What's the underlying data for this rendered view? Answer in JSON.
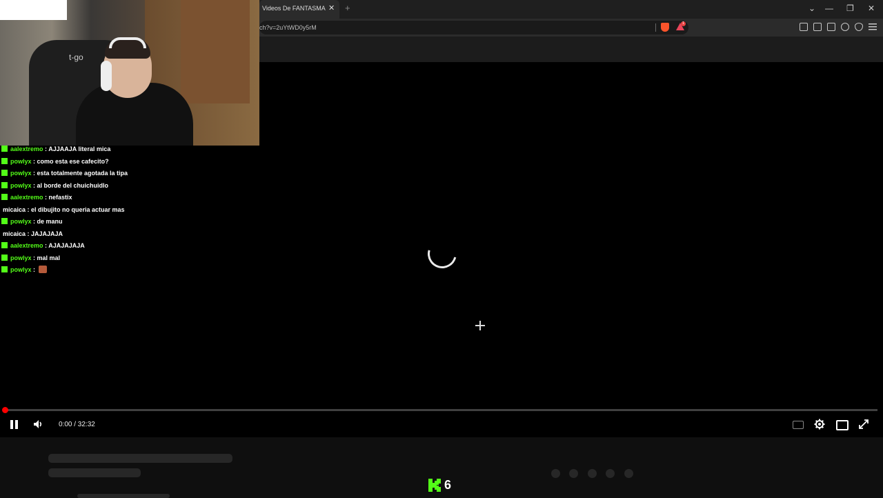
{
  "browser": {
    "tab_title": "Videos De FANTASMAS F",
    "tab_close": "✕",
    "new_tab": "+",
    "url": "ch?v=2uYtWD0y5rM",
    "rewards_badge": "1",
    "window_controls": {
      "dropdown": "⌄",
      "minimize": "—",
      "restore": "❐",
      "close": "✕"
    },
    "icons": [
      "extensions-icon",
      "sidebar-icon",
      "wallet-icon",
      "leo-ai-icon",
      "vpn-icon",
      "menu-icon"
    ]
  },
  "player": {
    "time": "0:00 / 32:32",
    "progress": 0,
    "state": "loading",
    "colors": {
      "progress": "#ff0000",
      "background": "#000000"
    }
  },
  "kick": {
    "viewer_count": "6",
    "brand_color": "#53fc18"
  },
  "webcam": {
    "chair_brand": "t-go"
  },
  "chat": {
    "messages": [
      {
        "user": "aalextremo",
        "color": "#53fc18",
        "badge": true,
        "text": "AJJAAJA literal mica"
      },
      {
        "user": "powlyx",
        "color": "#53fc18",
        "badge": true,
        "text": "como esta ese cafecito?"
      },
      {
        "user": "powlyx",
        "color": "#53fc18",
        "badge": true,
        "text": "esta totalmente agotada la tipa"
      },
      {
        "user": "powlyx",
        "color": "#53fc18",
        "badge": true,
        "text": "al borde del chuichuidlo"
      },
      {
        "user": "aalextremo",
        "color": "#53fc18",
        "badge": true,
        "text": "nefastix"
      },
      {
        "user": "micaica",
        "color": "#ffffff",
        "badge": false,
        "text": "el dibujito no queria actuar mas"
      },
      {
        "user": "powlyx",
        "color": "#53fc18",
        "badge": true,
        "text": "de manu"
      },
      {
        "user": "micaica",
        "color": "#ffffff",
        "badge": false,
        "text": "JAJAJAJA"
      },
      {
        "user": "aalextremo",
        "color": "#53fc18",
        "badge": true,
        "text": "AJAJAJAJA"
      },
      {
        "user": "powlyx",
        "color": "#53fc18",
        "badge": true,
        "text": "mal mal"
      },
      {
        "user": "powlyx",
        "color": "#53fc18",
        "badge": true,
        "text": "",
        "emote": true
      }
    ]
  }
}
